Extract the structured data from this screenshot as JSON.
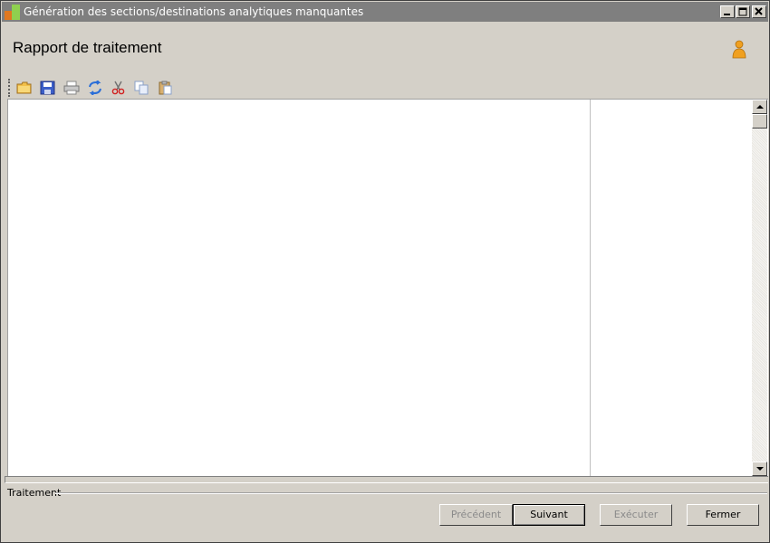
{
  "window": {
    "title": "Génération des sections/destinations analytiques manquantes",
    "icon": "app-icon",
    "controls": [
      "minimize-icon",
      "maximize-icon",
      "close-icon"
    ]
  },
  "header": {
    "title": "Rapport de traitement",
    "user_icon": "user-icon"
  },
  "toolbar": {
    "items": [
      "open-folder-icon",
      "save-icon",
      "print-icon",
      "refresh-icon",
      "cut-icon",
      "copy-icon",
      "paste-icon"
    ]
  },
  "group": {
    "label": "Traitement"
  },
  "buttons": {
    "previous": "Précédent",
    "next": "Suivant",
    "execute": "Exécuter",
    "close": "Fermer"
  },
  "colors": {
    "titlebar": "#7f7f7f",
    "window": "#d4d0c8",
    "panel": "#ffffff"
  }
}
